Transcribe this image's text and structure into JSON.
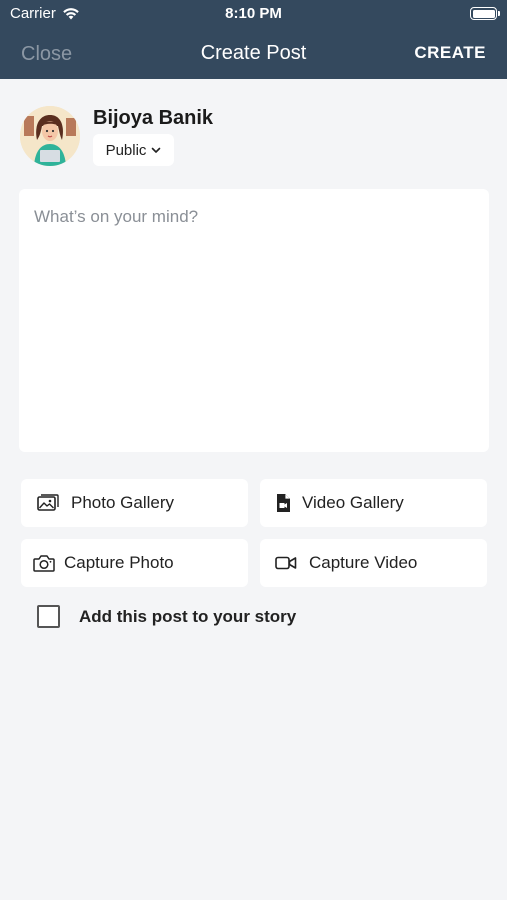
{
  "status_bar": {
    "carrier": "Carrier",
    "time": "8:10 PM"
  },
  "nav": {
    "close_label": "Close",
    "title": "Create Post",
    "create_label": "CREATE"
  },
  "user": {
    "name": "Bijoya Banik",
    "privacy": "Public"
  },
  "composer": {
    "placeholder": "What’s on your mind?",
    "value": ""
  },
  "actions": {
    "photo_gallery": "Photo Gallery",
    "video_gallery": "Video Gallery",
    "capture_photo": "Capture Photo",
    "capture_video": "Capture Video"
  },
  "story": {
    "label": "Add this post to your story",
    "checked": false
  },
  "colors": {
    "header": "#34495e",
    "background": "#f4f5f7",
    "card": "#ffffff"
  }
}
